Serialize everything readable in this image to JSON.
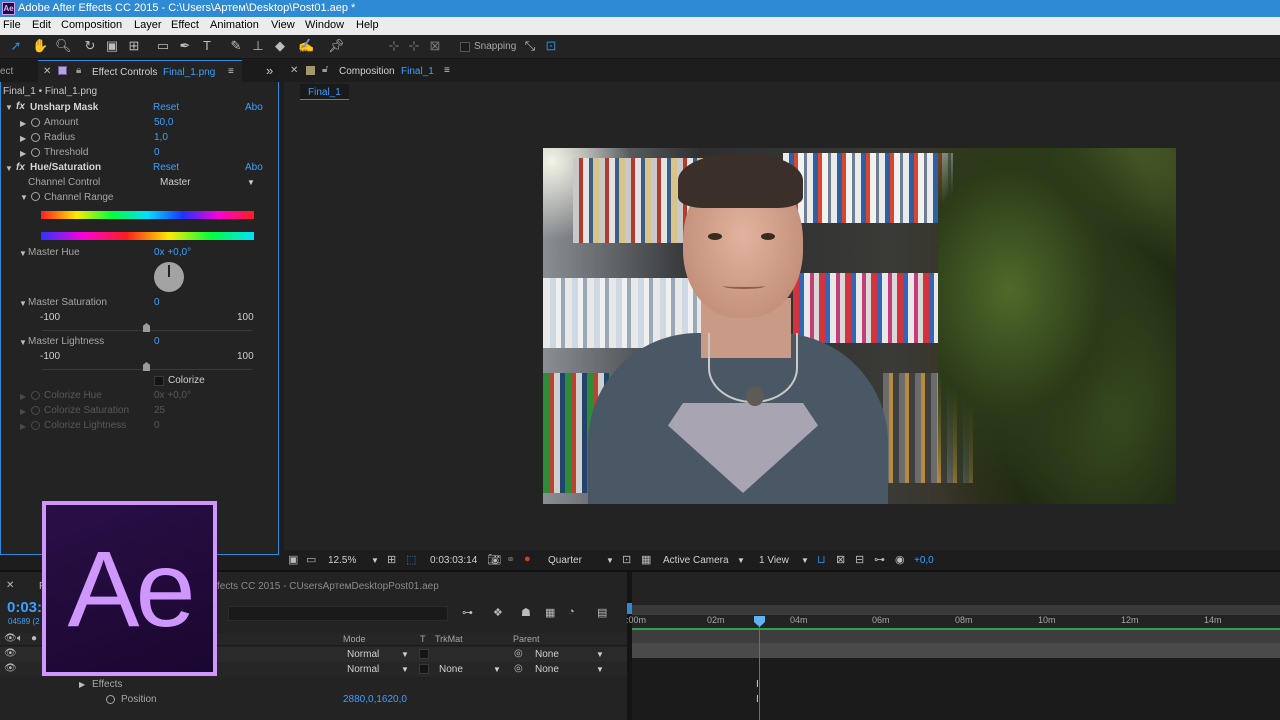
{
  "window": {
    "title": "Adobe After Effects CC 2015 - C:\\Users\\Артем\\Desktop\\Post01.aep *",
    "badge": "Ae"
  },
  "menu": [
    "File",
    "Edit",
    "Composition",
    "Layer",
    "Effect",
    "Animation",
    "View",
    "Window",
    "Help"
  ],
  "toolbar": {
    "snapping_label": "Snapping"
  },
  "effect_controls": {
    "left_tab_fragment": "ect",
    "tab_label": "Effect Controls",
    "tab_file": "Final_1.png",
    "overflow": "»",
    "breadcrumb": "Final_1 • Final_1.png",
    "unsharp": {
      "name": "Unsharp Mask",
      "reset": "Reset",
      "about": "Abo",
      "props": [
        {
          "label": "Amount",
          "value": "50,0"
        },
        {
          "label": "Radius",
          "value": "1,0"
        },
        {
          "label": "Threshold",
          "value": "0"
        }
      ]
    },
    "hue": {
      "name": "Hue/Saturation",
      "reset": "Reset",
      "about": "Abo",
      "channel_control_label": "Channel Control",
      "channel_control_value": "Master",
      "channel_range_label": "Channel Range",
      "master_hue_label": "Master Hue",
      "master_hue_value": "0x +0,0°",
      "master_sat_label": "Master Saturation",
      "master_sat_value": "0",
      "sat_min": "-100",
      "sat_max": "100",
      "master_light_label": "Master Lightness",
      "master_light_value": "0",
      "light_min": "-100",
      "light_max": "100",
      "colorize_label": "Colorize",
      "colorize_props": [
        {
          "label": "Colorize Hue",
          "value": "0x +0,0°"
        },
        {
          "label": "Colorize Saturation",
          "value": "25"
        },
        {
          "label": "Colorize Lightness",
          "value": "0"
        }
      ]
    }
  },
  "composition": {
    "tab_label": "Composition",
    "tab_name": "Final_1",
    "sub_tab": "Final_1",
    "footer": {
      "zoom": "12.5%",
      "timecode": "0:03:03:14",
      "resolution": "Quarter",
      "camera": "Active Camera",
      "views": "1 View",
      "exposure": "+0,0"
    }
  },
  "timeline": {
    "tab_fragment": "F",
    "title_fragment": "fects CC 2015 - CUsersАртемDesktopPost01.aep",
    "timecode": "0:03:",
    "frame": "04589 (2",
    "columns": {
      "mode": "Mode",
      "t": "T",
      "trkmat": "TrkMat",
      "parent": "Parent"
    },
    "rows": [
      {
        "mode": "Normal",
        "trkmat": "",
        "parent": "None"
      },
      {
        "mode": "Normal",
        "trkmat": "None",
        "parent": "None"
      }
    ],
    "effects_label": "Effects",
    "position_label": "Position",
    "position_value": "2880,0,1620,0",
    "ruler": [
      ":00m",
      "02m",
      "04m",
      "06m",
      "08m",
      "10m",
      "12m",
      "14m"
    ]
  },
  "logo_text": "Ae"
}
